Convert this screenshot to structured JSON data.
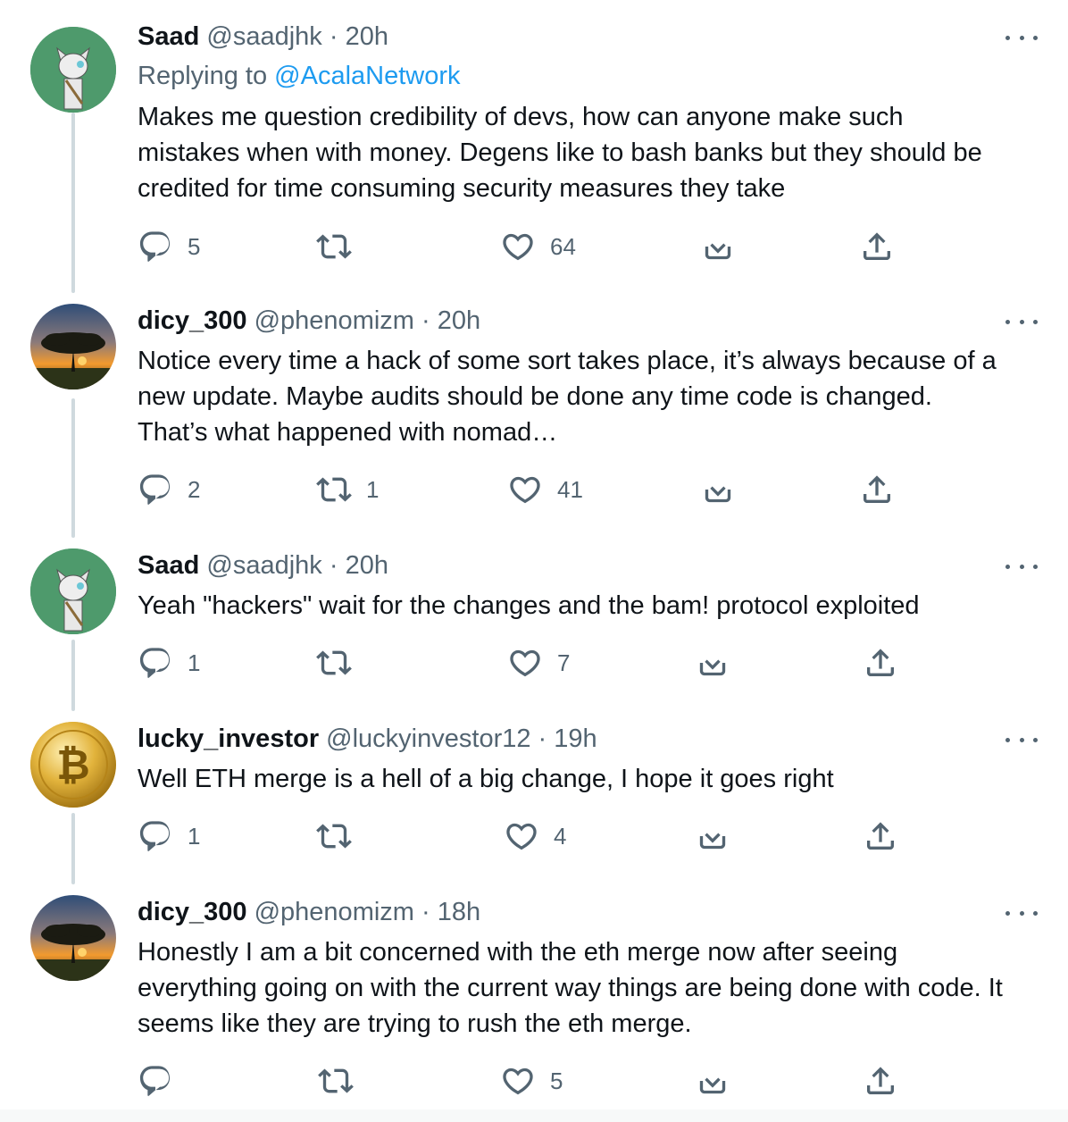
{
  "tweets": [
    {
      "name": "Saad",
      "handle": "@saadjhk",
      "dot": "·",
      "time": "20h",
      "replying_prefix": "Replying to ",
      "replying_to": "@AcalaNetwork",
      "text": "Makes me question credibility of devs, how can anyone make such\nmistakes when with money. Degens like to bash banks but they should be\ncredited for time consuming security measures they take",
      "replies": "5",
      "retweets": "",
      "likes": "64"
    },
    {
      "name": "dicy_300",
      "handle": "@phenomizm",
      "dot": "·",
      "time": "20h",
      "text": "Notice every time a hack of some sort takes place, it’s always because of a\nnew update. Maybe audits should be done any time code is changed.\nThat’s what happened with nomad…",
      "replies": "2",
      "retweets": "1",
      "likes": "41"
    },
    {
      "name": "Saad",
      "handle": "@saadjhk",
      "dot": "·",
      "time": "20h",
      "text": "Yeah \"hackers\" wait for the changes and the bam! protocol exploited",
      "replies": "1",
      "retweets": "",
      "likes": "7"
    },
    {
      "name": "lucky_investor",
      "handle": "@luckyinvestor12",
      "dot": "·",
      "time": "19h",
      "text": "Well ETH merge is a hell of a big change, I hope it goes right",
      "replies": "1",
      "retweets": "",
      "likes": "4"
    },
    {
      "name": "dicy_300",
      "handle": "@phenomizm",
      "dot": "·",
      "time": "18h",
      "text": "Honestly I am a bit concerned with the eth merge now after seeing\neverything going on with the current way things are being done with code. It\nseems like they are trying to rush the eth merge.",
      "replies": "",
      "retweets": "",
      "likes": "5"
    }
  ],
  "icons": {
    "reply": "reply-icon",
    "retweet": "retweet-icon",
    "like": "heart-icon",
    "download": "download-icon",
    "share": "share-icon",
    "more": "more-icon"
  },
  "colors": {
    "text": "#0f1419",
    "secondary": "#536471",
    "link": "#1d9bf0",
    "thread_line": "#cfd9de",
    "avatar_green": "#4e9a6c",
    "bitcoin_gold": "#d9a521"
  }
}
